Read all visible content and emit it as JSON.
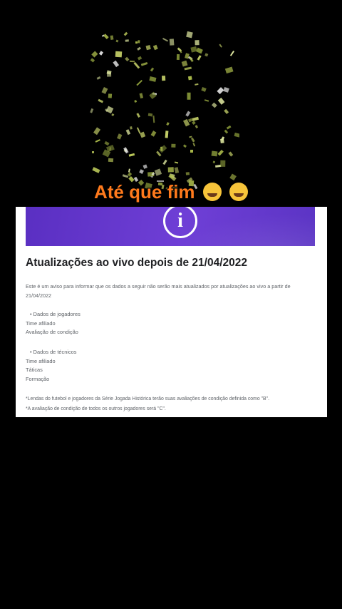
{
  "caption": {
    "text": "Até que fim"
  },
  "notice": {
    "title": "Atualizações ao vivo depois de 21/04/2022",
    "intro": "Este é um aviso para informar que os dados a seguir não serão mais atualizados por atualizações ao vivo a partir de 21/04/2022",
    "players_section": {
      "header": "Dados de jogadores",
      "items": [
        "Time afiliado",
        "Avaliação de condição"
      ]
    },
    "coaches_section": {
      "header": "Dados de técnicos",
      "items": [
        "Time afiliado",
        "Táticas",
        "Formação"
      ]
    },
    "footnotes": [
      "*Lendas do futebol e jogadores da Série Jogada Histórica terão suas avaliações de condição definida como \"B\".",
      "*A avaliação de condição de todos os outros jogadores será \"C\"."
    ]
  },
  "colors": {
    "caption": "#ff7a1c",
    "banner": "#5a2fc2",
    "confetti": "#c8d36a"
  },
  "icons": {
    "banner_icon": "info-icon",
    "emoji_1": "face-blowing-nose-emoji",
    "emoji_2": "star-struck-emoji"
  }
}
